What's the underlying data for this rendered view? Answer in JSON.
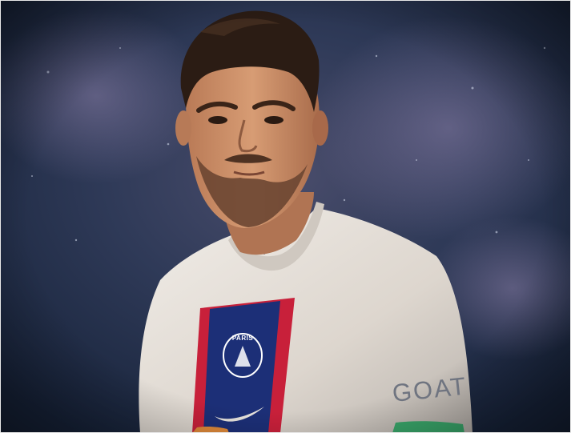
{
  "photo": {
    "subject": "footballer-portrait",
    "crest_text": "PARIS",
    "sleeve_text": "GOAT",
    "colors": {
      "background": "#2a3652",
      "shirt": "#e9e4de",
      "stripe_red": "#c8203a",
      "stripe_blue": "#1c2f77",
      "hair": "#2b1c14",
      "skin": "#c98a64"
    }
  }
}
